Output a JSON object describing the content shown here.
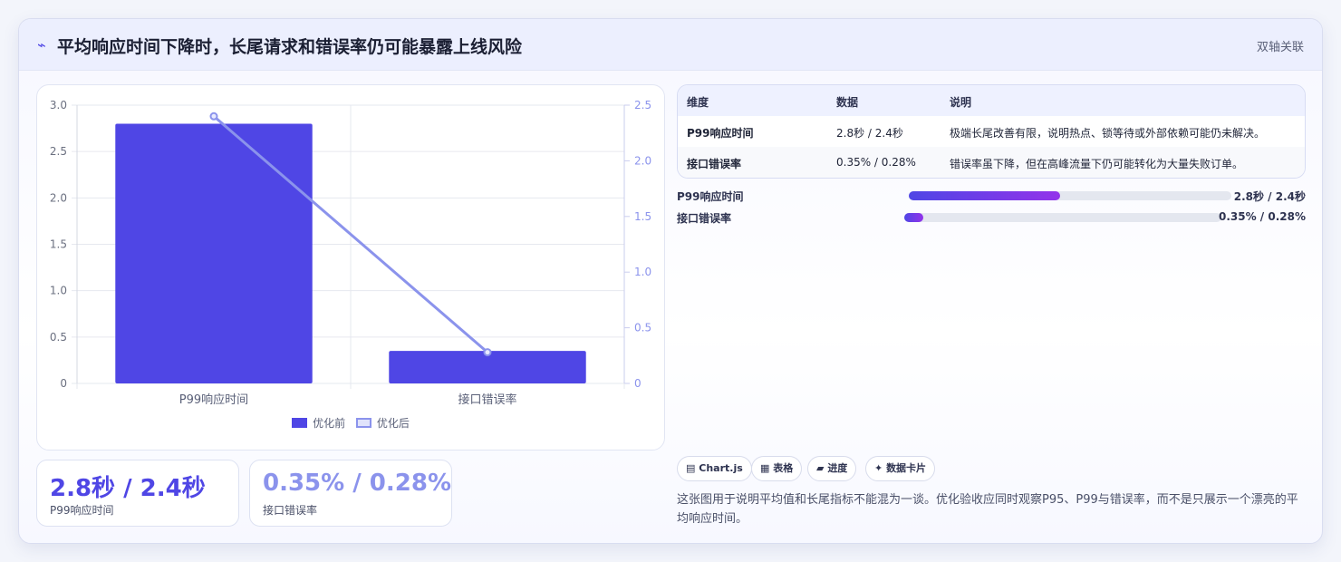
{
  "header": {
    "icon": "⌁",
    "title": "平均响应时间下降时，长尾请求和错误率仍可能暴露上线风险",
    "tag": "双轴关联"
  },
  "chart_data": {
    "type": "bar",
    "categories": [
      "P99响应时间",
      "接口错误率"
    ],
    "series": [
      {
        "name": "优化前",
        "type": "bar",
        "axis": "left",
        "values": [
          2.8,
          0.35
        ],
        "color": "#4f46e5"
      },
      {
        "name": "优化后",
        "type": "line",
        "axis": "right",
        "values": [
          2.4,
          0.28
        ],
        "color": "#8b93ec"
      }
    ],
    "y_left": {
      "min": 0,
      "max": 3.0,
      "ticks": [
        "0",
        "0.5",
        "1.0",
        "1.5",
        "2.0",
        "2.5",
        "3.0"
      ]
    },
    "y_right": {
      "min": 0,
      "max": 2.5,
      "ticks": [
        "0",
        "0.5",
        "1.0",
        "1.5",
        "2.0",
        "2.5"
      ]
    },
    "grid": true,
    "legend": "bottom"
  },
  "legend": {
    "before": "优化前",
    "after": "优化后"
  },
  "stats": [
    {
      "value": "2.8秒 / 2.4秒",
      "label": "P99响应时间",
      "color": "#4f46e5"
    },
    {
      "value": "0.35% / 0.28%",
      "label": "接口错误率",
      "color": "#8b93ec"
    }
  ],
  "table": {
    "headers": [
      "维度",
      "数据",
      "说明"
    ],
    "rows": [
      [
        "P99响应时间",
        "2.8秒 / 2.4秒",
        "极端长尾改善有限，说明热点、锁等待或外部依赖可能仍未解决。"
      ],
      [
        "接口错误率",
        "0.35% / 0.28%",
        "错误率虽下降，但在高峰流量下仍可能转化为大量失败订单。"
      ]
    ]
  },
  "progress": [
    {
      "label": "P99响应时间",
      "value": "2.8秒 / 2.4秒",
      "fraction": 0.47
    },
    {
      "label": "接口错误率",
      "value": "0.35% / 0.28%",
      "fraction": 0.06
    }
  ],
  "chips": [
    {
      "icon": "▤",
      "label": "Chart.js"
    },
    {
      "icon": "▦",
      "label": "表格"
    },
    {
      "icon": "▰",
      "label": "进度"
    },
    {
      "icon": "✦",
      "label": "数据卡片"
    }
  ],
  "description": "这张图用于说明平均值和长尾指标不能混为一谈。优化验收应同时观察P95、P99与错误率，而不是只展示一个漂亮的平均响应时间。"
}
